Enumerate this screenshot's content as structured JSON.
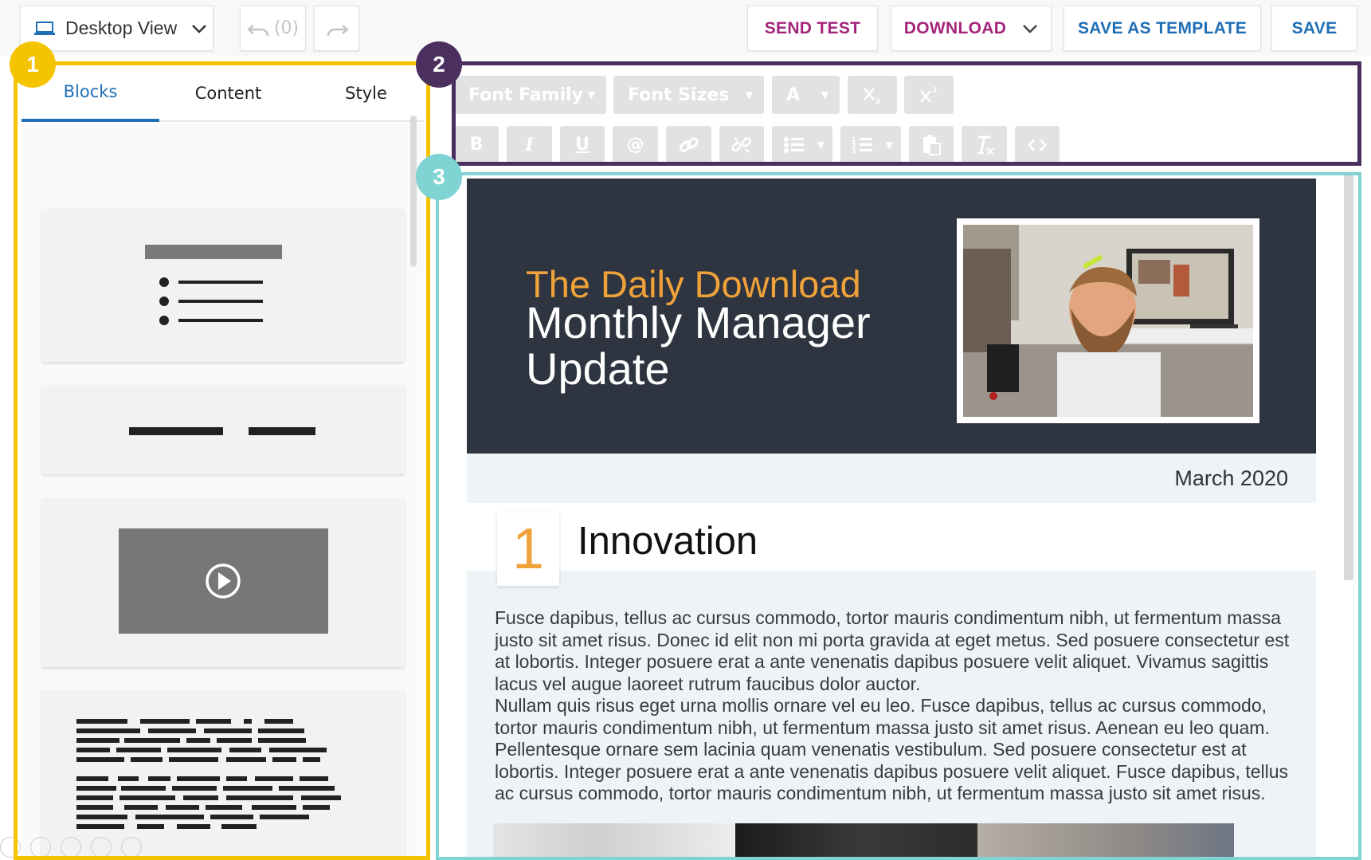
{
  "toolbar": {
    "view_label": "Desktop View",
    "undo_label": "(0)",
    "send_test": "SEND TEST",
    "download": "DOWNLOAD",
    "save_as_template": "SAVE AS TEMPLATE",
    "save": "SAVE"
  },
  "left_panel": {
    "tabs": [
      {
        "label": "Blocks",
        "active": true
      },
      {
        "label": "Content",
        "active": false
      },
      {
        "label": "Style",
        "active": false
      }
    ]
  },
  "format_toolbar": {
    "font_family": "Font Family",
    "font_sizes": "Font Sizes",
    "color": "A",
    "bold": "B",
    "italic": "I",
    "underline": "U",
    "at": "@"
  },
  "email": {
    "kicker": "The Daily Download",
    "title": "Monthly Manager Update",
    "date": "March 2020",
    "section_number": "1",
    "section_title": "Innovation",
    "paragraph_1": "Fusce dapibus, tellus ac cursus commodo, tortor mauris condimentum nibh, ut fermentum massa justo sit amet risus. Donec id elit non mi porta gravida at eget metus. Sed posuere consectetur est at lobortis. Integer posuere erat a ante venenatis dapibus posuere velit aliquet. Vivamus sagittis lacus vel augue laoreet rutrum faucibus dolor auctor.",
    "paragraph_2": "Nullam quis risus eget urna mollis ornare vel eu leo. Fusce dapibus, tellus ac cursus commodo, tortor mauris condimentum nibh, ut fermentum massa justo sit amet risus. Aenean eu leo quam. Pellentesque ornare sem lacinia quam venenatis vestibulum. Sed posuere consectetur est at lobortis. Integer posuere erat a ante venenatis dapibus posuere velit aliquet. Fusce dapibus, tellus ac cursus commodo, tortor mauris condimentum nibh, ut fermentum massa justo sit amet risus."
  },
  "markers": [
    "1",
    "2",
    "3"
  ],
  "colors": {
    "accent_magenta": "#a4267a",
    "accent_blue": "#1f6fb6",
    "hero_bg": "#2f3540",
    "kicker_orange": "#f0a23a",
    "frame_1": "#f5c400",
    "frame_2": "#4a2f5f",
    "frame_3": "#7fd3d3"
  }
}
